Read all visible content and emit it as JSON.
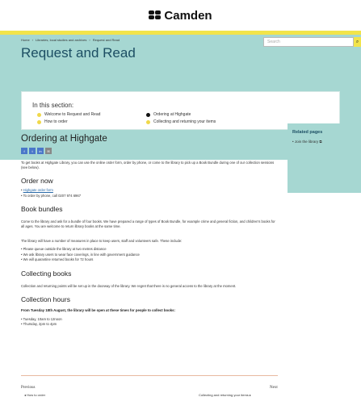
{
  "brand": {
    "name": "Camden"
  },
  "breadcrumb": [
    "Home",
    "Libraries, local studies and archives",
    "Request and Read"
  ],
  "page_title": "Request and Read",
  "search": {
    "placeholder": "Search",
    "button_icon": "search-icon"
  },
  "in_this_section": {
    "heading": "In this section:",
    "links": [
      {
        "label": "Welcome to Request and Read",
        "current": false
      },
      {
        "label": "How to order",
        "current": false
      },
      {
        "label": "Ordering at Highgate",
        "current": true
      },
      {
        "label": "Collecting and returning your items",
        "current": false
      }
    ]
  },
  "article": {
    "title": "Ordering at Highgate",
    "share": [
      "f",
      "t",
      "in",
      "✉"
    ],
    "intro": "To get books at Highgate Library, you can use the online order form, order by phone, or come to the library to pick up a Book Bundle during one of our collection sessions (see below).",
    "order_now": {
      "heading": "Order now",
      "items": [
        "Highgate order form",
        "To order by phone, call 0207 974 6967"
      ]
    },
    "book_bundles": {
      "heading": "Book bundles",
      "text": "Come to the library and ask for a bundle of four books.  We have prepared a range of types of Book Bundle, for example crime and general fiction, and children's books for all ages.  You are welcome to return library books at the same time."
    },
    "measures": {
      "text": "The library will have a number of measures in place to keep users, staff and volunteers safe. These include:",
      "items": [
        "Please queue outside the library at two metres distance",
        "We ask library users to wear face coverings, in line with government guidance",
        "We will quarantine returned books for 72 hours"
      ]
    },
    "collecting": {
      "heading": "Collecting books",
      "text": "Collection and returning points will be set up in the doorway of the library.  We regret that there is no general access to the library at the moment."
    },
    "hours": {
      "heading": "Collection hours",
      "bold": "From Tuesday 18th August, the library will be open at these times for people to collect books:",
      "items": [
        "Tuesday, 10am to 12noon",
        "Thursday, 2pm to 4pm"
      ]
    }
  },
  "related": {
    "title": "Related pages",
    "links": [
      "Join the library"
    ]
  },
  "pager": {
    "previous_label": "Previous",
    "previous_link": "How to order",
    "next_label": "Next",
    "next_link": "Collecting and returning your items"
  },
  "colors": {
    "hero": "#a6d7d2",
    "accent": "#f2e44a",
    "title": "#1c4e63"
  }
}
